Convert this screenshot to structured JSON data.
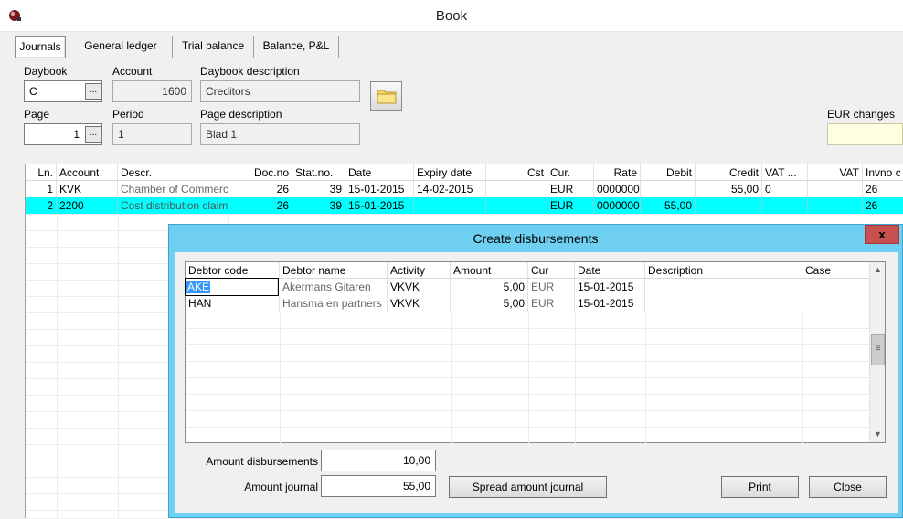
{
  "window": {
    "title": "Book"
  },
  "tabs": [
    "Journals",
    "General ledger",
    "Trial balance",
    "Balance, P&L"
  ],
  "form": {
    "daybook_label": "Daybook",
    "daybook_value": "C",
    "account_label": "Account",
    "account_value": "1600",
    "daybook_desc_label": "Daybook description",
    "daybook_desc_value": "Creditors",
    "page_label": "Page",
    "page_value": "1",
    "period_label": "Period",
    "period_value": "1",
    "page_desc_label": "Page description",
    "page_desc_value": "Blad 1",
    "eur_changes_label": "EUR changes",
    "browse_label": "..."
  },
  "journal": {
    "columns": [
      "Ln.",
      "Account",
      "Descr.",
      "Doc.no",
      "Stat.no.",
      "Date",
      "Expiry date",
      "Cst",
      "Cur.",
      "Rate",
      "Debit",
      "Credit",
      "VAT ...",
      "VAT",
      "Invno c"
    ],
    "rows": [
      [
        "1",
        "KVK",
        "Chamber of Commerc",
        "26",
        "39",
        "15-01-2015",
        "14-02-2015",
        "",
        "EUR",
        "00000000",
        "",
        "55,00",
        "0",
        "",
        "26"
      ],
      [
        "2",
        "2200",
        "Cost distribution claim",
        "26",
        "39",
        "15-01-2015",
        "",
        "",
        "EUR",
        "00000000",
        "55,00",
        "",
        "",
        "",
        "26"
      ]
    ]
  },
  "dialog": {
    "title": "Create disbursements",
    "close_glyph": "x",
    "columns": [
      "Debtor code",
      "Debtor name",
      "Activity",
      "Amount",
      "Cur",
      "Date",
      "Description",
      "Case"
    ],
    "rows": [
      [
        "AKE",
        "Akermans Gitaren",
        "VKVK",
        "5,00",
        "EUR",
        "15-01-2015",
        "",
        ""
      ],
      [
        "HAN",
        "Hansma en partners",
        "VKVK",
        "5,00",
        "EUR",
        "15-01-2015",
        "",
        ""
      ]
    ],
    "amount_disbursements_label": "Amount disbursements",
    "amount_disbursements_value": "10,00",
    "amount_journal_label": "Amount journal",
    "amount_journal_value": "55,00",
    "spread_button": "Spread amount journal",
    "print_button": "Print",
    "close_button": "Close",
    "scroll_up": "▲",
    "scroll_down": "▼",
    "scroll_grip": "≡"
  }
}
